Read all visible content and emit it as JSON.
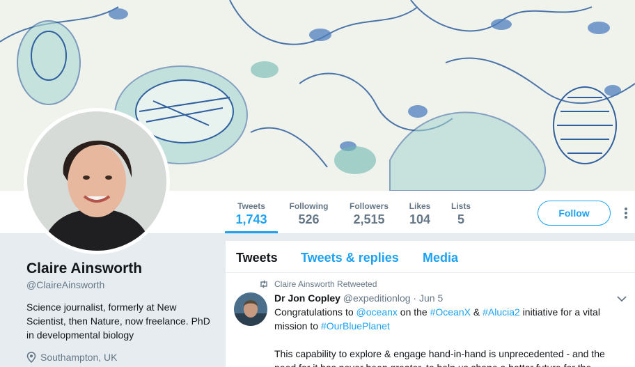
{
  "header": {
    "banner_name": "header-illustration"
  },
  "nav": {
    "stats": [
      {
        "label": "Tweets",
        "value": "1,743"
      },
      {
        "label": "Following",
        "value": "526"
      },
      {
        "label": "Followers",
        "value": "2,515"
      },
      {
        "label": "Likes",
        "value": "104"
      },
      {
        "label": "Lists",
        "value": "5"
      }
    ],
    "follow_label": "Follow"
  },
  "profile": {
    "name": "Claire Ainsworth",
    "handle": "@ClaireAinsworth",
    "bio": "Science journalist, formerly at New Scientist, then Nature, now freelance. PhD in developmental biology",
    "location": "Southampton, UK"
  },
  "timeline": {
    "tabs": [
      "Tweets",
      "Tweets & replies",
      "Media"
    ],
    "tweet": {
      "retweeted_by": "Claire Ainsworth Retweeted",
      "author": "Dr Jon Copley",
      "handle": "@expeditionlog",
      "dot": "·",
      "date": "Jun 5",
      "text": {
        "p1": "Congratulations to ",
        "mention": "@oceanx",
        "p2": " on the ",
        "tag1": "#OceanX",
        "p3": " & ",
        "tag2": "#Alucia2",
        "p4": " initiative for a vital mission to ",
        "tag3": "#OurBluePlanet"
      },
      "text2": "This capability to explore & engage hand-in-hand is unprecedented - and the need for it has never been greater, to help us shape a better future for the"
    }
  },
  "colors": {
    "accent": "#1da1f2",
    "muted": "#657786",
    "background": "#e6ecf0"
  }
}
